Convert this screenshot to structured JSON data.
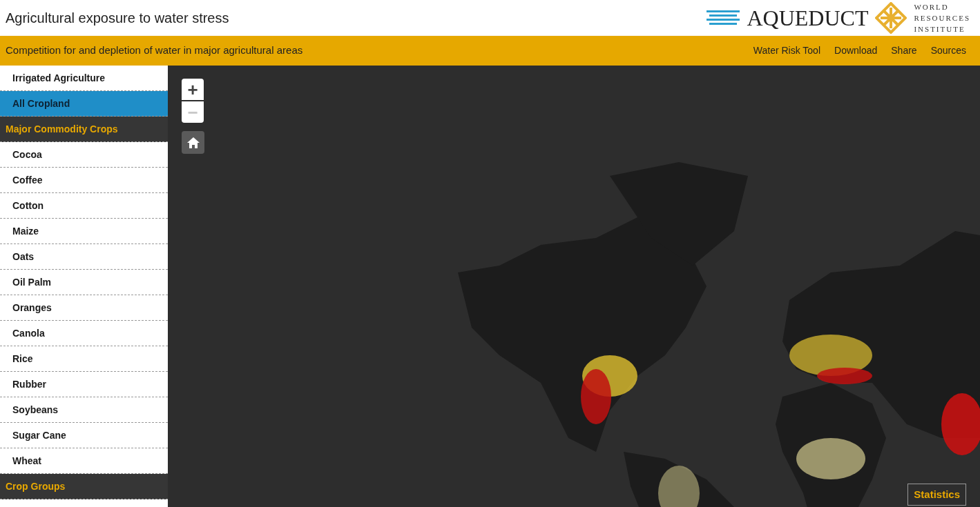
{
  "header": {
    "title": "Agricultural exposure to water stress",
    "logo_text": "AQUEDUCT",
    "org_lines": [
      "WORLD",
      "RESOURCES",
      "INSTITUTE"
    ]
  },
  "subheader": {
    "text": "Competition for and depletion of water in major agricultural areas",
    "links": [
      "Water Risk Tool",
      "Download",
      "Share",
      "Sources"
    ]
  },
  "sidebar": {
    "items": [
      {
        "kind": "item",
        "label": "Irrigated Agriculture",
        "selected": false
      },
      {
        "kind": "item",
        "label": "All Cropland",
        "selected": true
      },
      {
        "kind": "header",
        "label": "Major Commodity Crops"
      },
      {
        "kind": "item",
        "label": "Cocoa",
        "selected": false
      },
      {
        "kind": "item",
        "label": "Coffee",
        "selected": false
      },
      {
        "kind": "item",
        "label": "Cotton",
        "selected": false
      },
      {
        "kind": "item",
        "label": "Maize",
        "selected": false
      },
      {
        "kind": "item",
        "label": "Oats",
        "selected": false
      },
      {
        "kind": "item",
        "label": "Oil Palm",
        "selected": false
      },
      {
        "kind": "item",
        "label": "Oranges",
        "selected": false
      },
      {
        "kind": "item",
        "label": "Canola",
        "selected": false
      },
      {
        "kind": "item",
        "label": "Rice",
        "selected": false
      },
      {
        "kind": "item",
        "label": "Rubber",
        "selected": false
      },
      {
        "kind": "item",
        "label": "Soybeans",
        "selected": false
      },
      {
        "kind": "item",
        "label": "Sugar Cane",
        "selected": false
      },
      {
        "kind": "item",
        "label": "Wheat",
        "selected": false
      },
      {
        "kind": "header",
        "label": "Crop Groups"
      }
    ]
  },
  "map": {
    "zoom_in": {
      "label": "+",
      "disabled": false
    },
    "zoom_out": {
      "label": "−",
      "disabled": true
    },
    "statistics_button": "Statistics"
  }
}
